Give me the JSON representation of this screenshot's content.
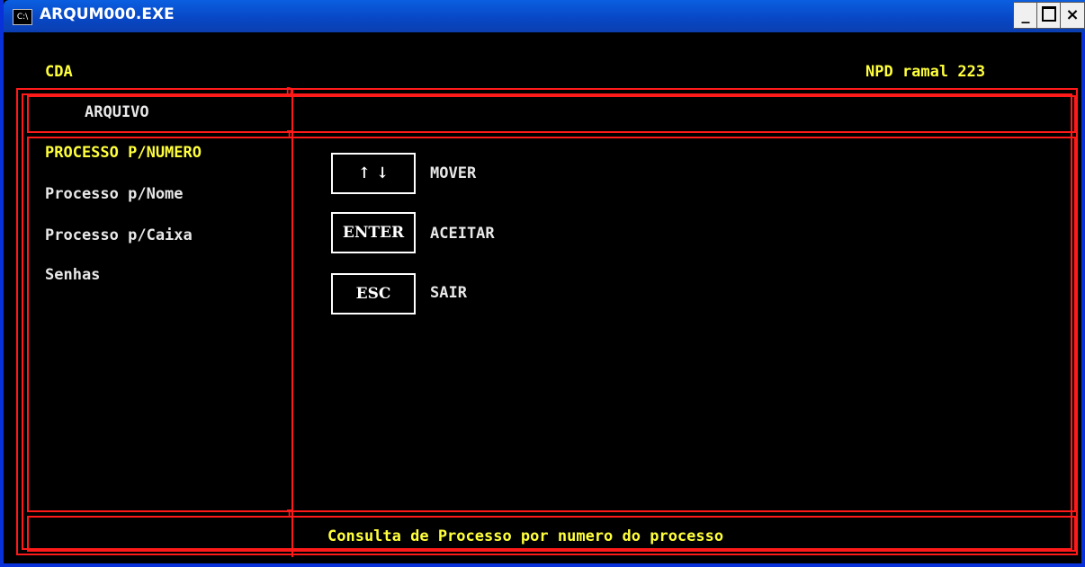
{
  "window": {
    "title": "ARQUM000.EXE",
    "icon_text": "C:\\",
    "min_label": "_",
    "close_label": "×"
  },
  "header": {
    "left": "CDA",
    "right": "NPD ramal 223"
  },
  "section": {
    "label": "ARQUIVO"
  },
  "menu": {
    "items": [
      {
        "label": "PROCESSO P/NUMERO",
        "selected": true
      },
      {
        "label": "Processo p/Nome"
      },
      {
        "label": "Processo p/Caixa"
      },
      {
        "label": "Senhas"
      }
    ]
  },
  "keys": [
    {
      "key": "↑ ↓",
      "action": "MOVER"
    },
    {
      "key": "ENTER",
      "action": "ACEITAR"
    },
    {
      "key": "ESC",
      "action": "SAIR"
    }
  ],
  "status": {
    "text": "Consulta de Processo por numero do processo"
  },
  "colors": {
    "background": "#000000",
    "frame": "#ff1a1a",
    "highlight": "#ffff3c",
    "text": "#e8e8e8",
    "titlebar": "#0846c4"
  }
}
